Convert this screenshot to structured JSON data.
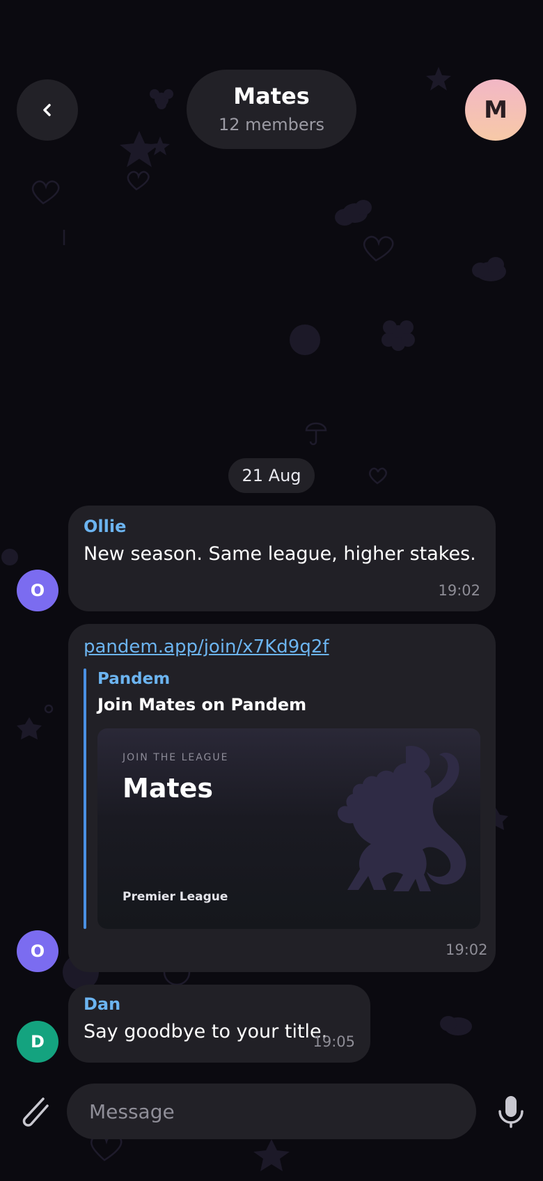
{
  "header": {
    "title": "Mates",
    "subtitle": "12 members",
    "group_avatar_initial": "M"
  },
  "date_separator": "21 Aug",
  "messages": [
    {
      "sender": "Ollie",
      "avatar_initial": "O",
      "avatar_color": "#7b6cf0",
      "text": "New season. Same league, higher stakes.",
      "time": "19:02"
    },
    {
      "avatar_initial": "O",
      "avatar_color": "#7b6cf0",
      "link": "pandem.app/join/x7Kd9q2f",
      "preview": {
        "site": "Pandem",
        "title": "Join Mates on Pandem",
        "card_kicker": "JOIN THE LEAGUE",
        "card_title": "Mates",
        "card_subtitle": "Premier League"
      },
      "time": "19:02"
    },
    {
      "sender": "Dan",
      "avatar_initial": "D",
      "avatar_color": "#14a37f",
      "text": "Say goodbye to your title.",
      "time": "19:05"
    }
  ],
  "composer": {
    "placeholder": "Message"
  },
  "colors": {
    "background": "#0b0a10",
    "bubble": "#212026",
    "accent_link": "#6cb4f0"
  },
  "icons": [
    "back-chevron-icon",
    "paperclip-icon",
    "microphone-icon"
  ]
}
